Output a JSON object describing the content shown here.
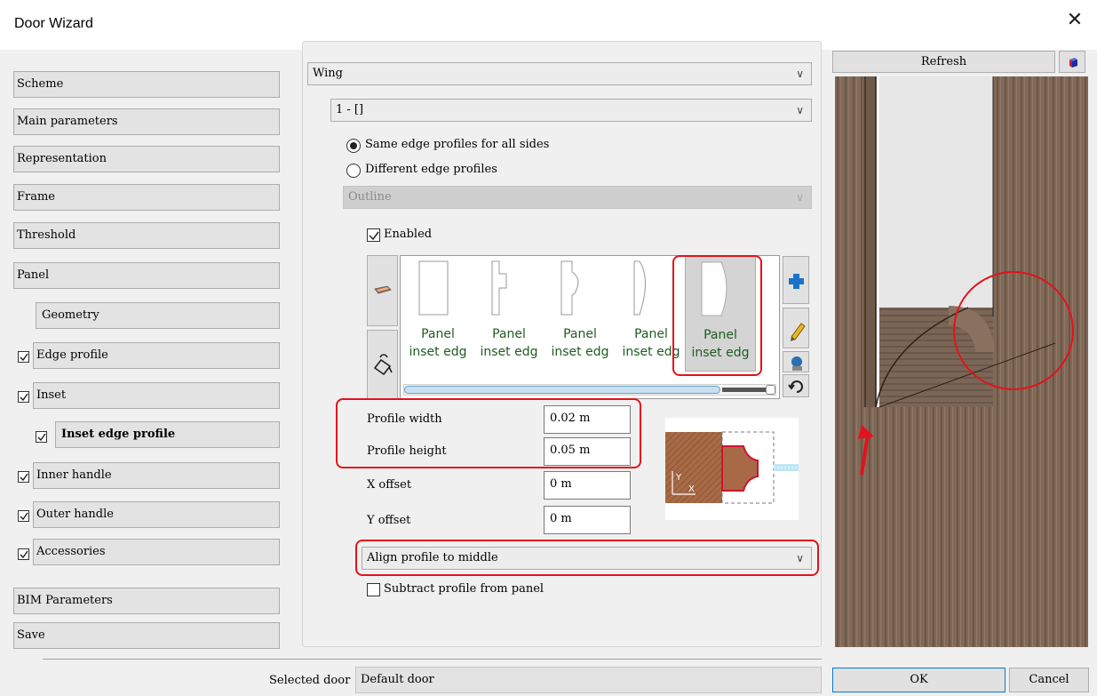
{
  "window": {
    "title": "Door Wizard"
  },
  "nav": {
    "scheme": "Scheme",
    "main_parameters": "Main parameters",
    "representation": "Representation",
    "frame": "Frame",
    "threshold": "Threshold",
    "panel": "Panel",
    "geometry": "Geometry",
    "edge_profile": "Edge profile",
    "inset": "Inset",
    "inset_edge_profile": "Inset edge profile",
    "inner_handle": "Inner handle",
    "outer_handle": "Outer handle",
    "accessories": "Accessories",
    "bim_parameters": "BIM Parameters",
    "save": "Save",
    "checked": {
      "edge_profile": true,
      "inset": true,
      "inset_edge_profile": true,
      "inner_handle": true,
      "outer_handle": true,
      "accessories": true
    }
  },
  "main": {
    "part_select": "Wing",
    "sub_select": "1 - []",
    "radio_same": "Same edge profiles for all sides",
    "radio_different": "Different edge profiles",
    "radio_selected": "same",
    "outline_select": "Outline",
    "enabled_label": "Enabled",
    "enabled_checked": true,
    "profiles": [
      {
        "line1": "Panel",
        "line2": "inset edg",
        "selected": false
      },
      {
        "line1": "Panel",
        "line2": "inset edg",
        "selected": false
      },
      {
        "line1": "Panel",
        "line2": "inset edg",
        "selected": false
      },
      {
        "line1": "Panel",
        "line2": "inset edg",
        "selected": false
      },
      {
        "line1": "Panel",
        "line2": "inset edg",
        "selected": true
      }
    ],
    "profile_width_label": "Profile width",
    "profile_width_value": "0.02 m",
    "profile_height_label": "Profile height",
    "profile_height_value": "0.05 m",
    "x_offset_label": "X offset",
    "x_offset_value": "0 m",
    "y_offset_label": "Y offset",
    "y_offset_value": "0 m",
    "align_select": "Align profile to middle",
    "subtract_label": "Subtract profile from panel",
    "subtract_checked": false
  },
  "diagram": {
    "axis_y": "Y",
    "axis_x": "X"
  },
  "preview": {
    "refresh_label": "Refresh",
    "icon": "cube-icon"
  },
  "footer": {
    "selected_door_label": "Selected door",
    "selected_door_value": "Default door",
    "ok_label": "OK",
    "cancel_label": "Cancel"
  },
  "colors": {
    "highlight": "#e4121b",
    "wood": "#7a6350",
    "profile_text": "#1e5c1e"
  }
}
